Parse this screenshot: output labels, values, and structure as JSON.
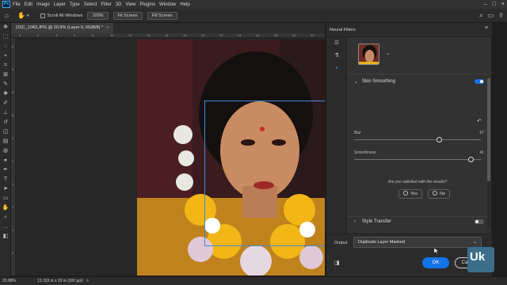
{
  "app": {
    "logo_text": "Ps"
  },
  "menubar": {
    "items": [
      "File",
      "Edit",
      "Image",
      "Layer",
      "Type",
      "Select",
      "Filter",
      "3D",
      "View",
      "Plugins",
      "Window",
      "Help"
    ],
    "right_icons": [
      "minimize-icon",
      "maximize-icon",
      "close-icon"
    ]
  },
  "options_bar": {
    "scroll_all_windows": "Scroll All Windows",
    "zoom_button": "100%",
    "fit_screen": "Fit Screen",
    "fill_screen": "Fill Screen"
  },
  "document": {
    "tab_title": "DSC_1043.JPG @ 20.9% (Layer 0, RGB/8) *",
    "close": "×"
  },
  "rulers": {
    "top": [
      "0",
      "2",
      "4",
      "6",
      "8",
      "10",
      "12",
      "14",
      "16",
      "18",
      "20",
      "22",
      "24",
      "26",
      "28",
      "30",
      "32"
    ],
    "left": [
      "2",
      "4",
      "6",
      "8",
      "1",
      "1",
      "1",
      "1",
      "1",
      "2"
    ]
  },
  "status_bar": {
    "zoom": "20.88%",
    "dimensions": "13.333 in x 20 in (300 ppi)",
    "arrow": ">"
  },
  "neural_filters": {
    "title": "Neural Filters",
    "skin_smoothing": {
      "label": "Skin Smoothing",
      "enabled": true,
      "blur_label": "Blur",
      "blur_value": "67",
      "blur_level": 0.67,
      "smoothness_label": "Smoothness",
      "smoothness_value": "41",
      "smoothness_level": 0.92
    },
    "feedback": {
      "question": "Are you satisfied with the results?",
      "yes": "Yes",
      "no": "No"
    },
    "style_transfer": {
      "label": "Style Transfer",
      "enabled": false
    },
    "output": {
      "label": "Output",
      "value": "Duplicate Layer Masked"
    },
    "ok_label": "OK",
    "cancel_label": "Cancel"
  },
  "watermark": {
    "text": "Uk"
  },
  "colors": {
    "accent": "#1473e6",
    "toggle_on": "#1473e6",
    "toggle_off": "#5a5a5a",
    "panel_bg": "#323232",
    "face_box": "#3e8ddd"
  }
}
